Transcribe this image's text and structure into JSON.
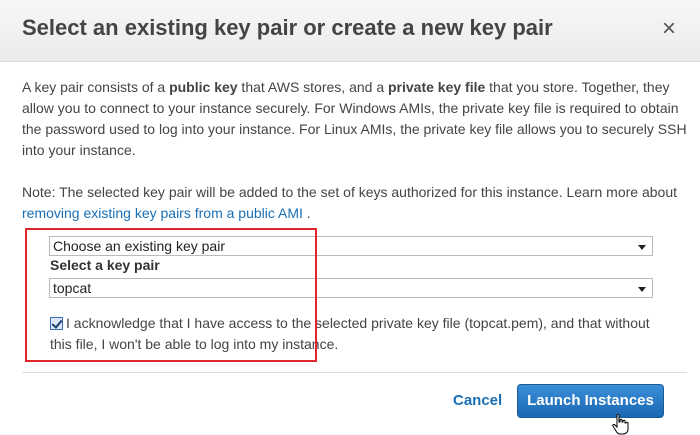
{
  "dialog": {
    "title": "Select an existing key pair or create a new key pair",
    "close_glyph": "×",
    "close_icon": "close-icon"
  },
  "description": {
    "p1": "A key pair consists of a ",
    "b1": "public key",
    "p2": " that AWS stores, and a ",
    "b2": "private key file",
    "p3": " that you store. Together, they allow you to connect to your instance securely. For Windows AMIs, the private key file is required to obtain the password used to log into your instance. For Linux AMIs, the private key file allows you to securely SSH into your instance."
  },
  "note": {
    "text": "Note: The selected key pair will be added to the set of keys authorized for this instance. Learn more about ",
    "link": "removing existing key pairs from a public AMI",
    "suffix": " ."
  },
  "keypair_mode": {
    "selected": "Choose an existing key pair"
  },
  "keypair_select": {
    "label": "Select a key pair",
    "selected": "topcat"
  },
  "acknowledge": {
    "checked": true,
    "text": "I acknowledge that I have access to the selected private key file (topcat.pem), and that without this file, I won't be able to log into my instance."
  },
  "actions": {
    "cancel": "Cancel",
    "launch": "Launch Instances"
  },
  "colors": {
    "primary_button": "#1b67b3",
    "link": "#1a6fb4",
    "highlight_box": "#e0262b"
  }
}
